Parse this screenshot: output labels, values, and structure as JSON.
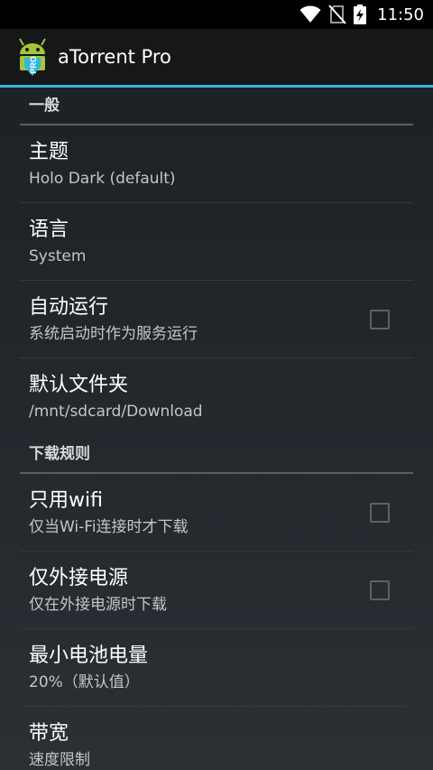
{
  "status_bar": {
    "time": "11:50",
    "icons": [
      "wifi-icon",
      "no-sim-icon",
      "battery-charging-icon"
    ]
  },
  "action_bar": {
    "app_icon": "android-pro-icon",
    "title": "aTorrent Pro"
  },
  "sections": [
    {
      "header": "一般",
      "items": [
        {
          "title": "主题",
          "summary": "Holo Dark (default)",
          "checkbox": false
        },
        {
          "title": "语言",
          "summary": "System",
          "checkbox": false
        },
        {
          "title": "自动运行",
          "summary": "系统启动时作为服务运行",
          "checkbox": true,
          "checked": false
        },
        {
          "title": "默认文件夹",
          "summary": "/mnt/sdcard/Download",
          "checkbox": false
        }
      ]
    },
    {
      "header": "下载规则",
      "items": [
        {
          "title": "只用wifi",
          "summary": "仅当Wi-Fi连接时才下载",
          "checkbox": true,
          "checked": false
        },
        {
          "title": "仅外接电源",
          "summary": "仅在外接电源时下载",
          "checkbox": true,
          "checked": false
        },
        {
          "title": "最小电池电量",
          "summary": "20%（默认值）",
          "checkbox": false
        },
        {
          "title": "带宽",
          "summary": "速度限制",
          "checkbox": false
        }
      ]
    }
  ],
  "colors": {
    "accent": "#33b5e5",
    "background": "#1c1f23",
    "action_bar": "#151719"
  }
}
